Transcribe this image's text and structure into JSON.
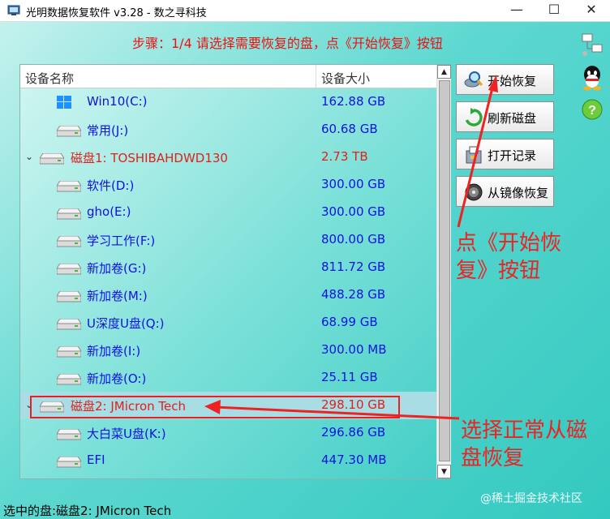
{
  "window": {
    "title": "光明数据恢复软件 v3.28 - 数之寻科技",
    "minimize": "—",
    "maximize": "☐",
    "close": "✕"
  },
  "step_text": "步骤：1/4 请选择需要恢复的盘，点《开始恢复》按钮",
  "table": {
    "columns": [
      "设备名称",
      "设备大小"
    ],
    "rows": [
      {
        "name": "Win10(C:)",
        "size": "162.88 GB",
        "kind": "child",
        "icon": "windows-icon"
      },
      {
        "name": "常用(J:)",
        "size": "60.68 GB",
        "kind": "child",
        "icon": "drive-icon"
      },
      {
        "name": "磁盘1: TOSHIBAHDWD130",
        "size": "2.73 TB",
        "kind": "disk",
        "icon": "drive-icon"
      },
      {
        "name": " 软件(D:)",
        "size": "300.00 GB",
        "kind": "child",
        "icon": "drive-icon"
      },
      {
        "name": "gho(E:)",
        "size": "300.00 GB",
        "kind": "child",
        "icon": "drive-icon"
      },
      {
        "name": "学习工作(F:)",
        "size": "800.00 GB",
        "kind": "child",
        "icon": "drive-icon"
      },
      {
        "name": "新加卷(G:)",
        "size": "811.72 GB",
        "kind": "child",
        "icon": "drive-icon"
      },
      {
        "name": "新加卷(M:)",
        "size": "488.28 GB",
        "kind": "child",
        "icon": "drive-icon"
      },
      {
        "name": "U深度U盘(Q:)",
        "size": "68.99 GB",
        "kind": "child",
        "icon": "drive-icon"
      },
      {
        "name": "新加卷(I:)",
        "size": "300.00 MB",
        "kind": "child",
        "icon": "drive-icon"
      },
      {
        "name": "新加卷(O:)",
        "size": "25.11 GB",
        "kind": "child",
        "icon": "drive-icon"
      },
      {
        "name": "磁盘2: JMicron  Tech",
        "size": "298.10 GB",
        "kind": "disk",
        "icon": "drive-icon",
        "selected": true
      },
      {
        "name": "大白菜U盘(K:)",
        "size": "296.86 GB",
        "kind": "child",
        "icon": "drive-icon"
      },
      {
        "name": "EFI",
        "size": "447.30 MB",
        "kind": "child",
        "icon": "drive-icon"
      }
    ]
  },
  "actions": [
    {
      "label": "开始恢复",
      "icon": "search-disk-icon"
    },
    {
      "label": "刷新磁盘",
      "icon": "refresh-icon"
    },
    {
      "label": "打开记录",
      "icon": "open-record-icon"
    },
    {
      "label": "从镜像恢复",
      "icon": "disk-image-icon"
    }
  ],
  "side_icons": [
    "network-icon",
    "qq-icon",
    "help-icon"
  ],
  "annotations": {
    "click_start": "点《开始恢复》按钮",
    "choose_disk": "选择正常从磁盘恢复"
  },
  "status": "选中的盘:磁盘2: JMicron  Tech",
  "watermark": "@稀土掘金技术社区",
  "colors": {
    "accent_red": "#ee2222",
    "link_blue": "#1111dd",
    "teal": "#33c9c0"
  }
}
